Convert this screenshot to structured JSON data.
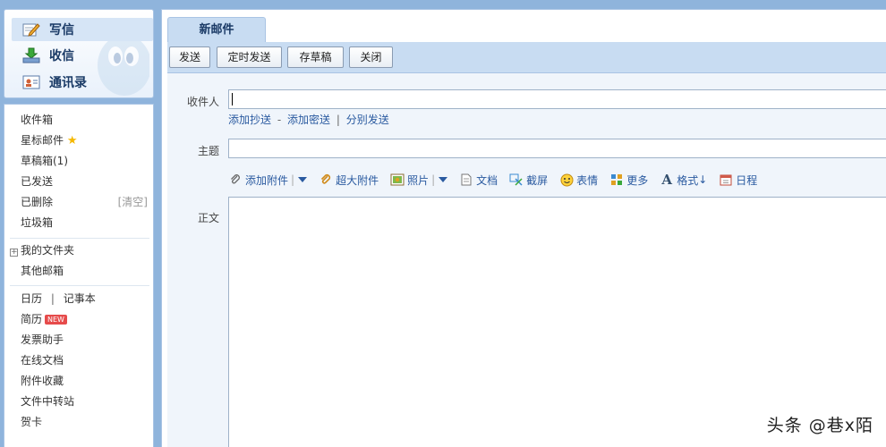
{
  "sidebar": {
    "compose": {
      "write": "写信",
      "inbox": "收信",
      "contacts": "通讯录"
    },
    "folders": {
      "inbox": "收件箱",
      "starred": "星标邮件",
      "drafts": "草稿箱(1)",
      "sent": "已发送",
      "deleted": "已删除",
      "deleted_action": "[清空]",
      "spam": "垃圾箱"
    },
    "my_folders": "我的文件夹",
    "other_mailboxes": "其他邮箱",
    "tools": {
      "calendar": "日历",
      "calendar_sep": "|",
      "notes": "记事本",
      "resume": "简历",
      "resume_badge": "NEW",
      "invoice": "发票助手",
      "online_docs": "在线文档",
      "attachments": "附件收藏",
      "file_transfer": "文件中转站",
      "cards": "贺卡"
    }
  },
  "main": {
    "tab": "新邮件",
    "toolbar": {
      "send": "发送",
      "scheduled": "定时发送",
      "save_draft": "存草稿",
      "close": "关闭"
    },
    "form": {
      "to_label": "收件人",
      "to_value": "",
      "cc": "添加抄送",
      "dash": "-",
      "bcc": "添加密送",
      "pipe": "|",
      "separate": "分别发送",
      "subject_label": "主题",
      "subject_value": "",
      "body_label": "正文",
      "attach": {
        "add_attachment": "添加附件",
        "large_attachment": "超大附件",
        "photo": "照片",
        "doc": "文档",
        "screenshot": "截屏",
        "emoji": "表情",
        "more": "更多",
        "format": "格式",
        "schedule": "日程"
      }
    }
  },
  "watermark": "头条 @巷x陌",
  "colors": {
    "frame": "#8fb4dc",
    "toolbar": "#c8dcf2",
    "link": "#2a5aa0",
    "badge": "#e64b4b",
    "star": "#f5b800"
  }
}
